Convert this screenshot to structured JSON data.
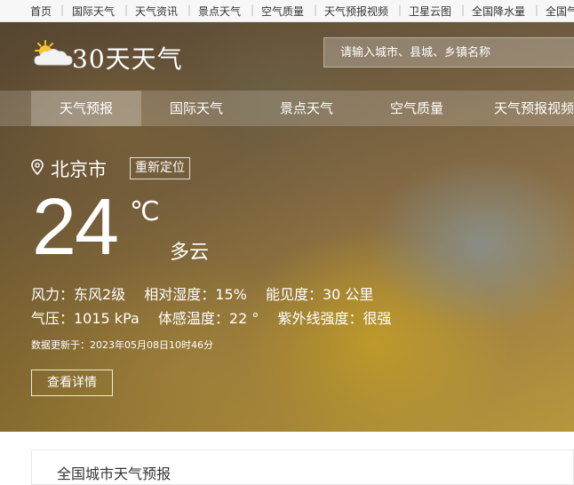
{
  "top_nav": {
    "items": [
      "首页",
      "国际天气",
      "天气资讯",
      "景点天气",
      "空气质量",
      "天气预报视频",
      "卫星云图",
      "全国降水量",
      "全国气"
    ]
  },
  "header": {
    "logo_text": "30天天气",
    "logo_icon": "sun-cloud-icon",
    "search_placeholder": "请输入城市、县城、乡镇名称"
  },
  "main_nav": {
    "tabs": [
      "天气预报",
      "国际天气",
      "景点天气",
      "空气质量",
      "天气预报视频"
    ],
    "active_index": 0
  },
  "weather": {
    "city": "北京市",
    "relocate_label": "重新定位",
    "temperature": "24",
    "unit": "℃",
    "condition": "多云",
    "row1": [
      "风力：东风2级",
      "相对湿度：15%",
      "能见度：30 公里"
    ],
    "row2": [
      "气压：1015 kPa",
      "体感温度：22 °",
      "紫外线强度：很强"
    ],
    "updated": "数据更新于：2023年05月08日10时46分",
    "details_button": "查看详情"
  },
  "bottom": {
    "title": "全国城市天气预报"
  },
  "colors": {
    "text_on_hero": "#ffffff",
    "top_nav_bg": "#f7f7f7"
  }
}
